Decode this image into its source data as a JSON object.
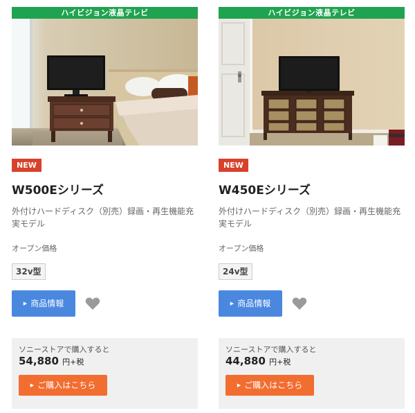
{
  "products": [
    {
      "category_banner": "ハイビジョン液晶テレビ",
      "badge": "NEW",
      "name": "W500Eシリーズ",
      "description": "外付けハードディスク（別売）録画・再生機能充実モデル",
      "price_label": "オープン価格",
      "size": "32v型",
      "info_button": "商品情報",
      "store_label": "ソニーストアで購入すると",
      "store_price": "54,880",
      "tax_suffix": "円+税",
      "buy_button": "ご購入はこちら"
    },
    {
      "category_banner": "ハイビジョン液晶テレビ",
      "badge": "NEW",
      "name": "W450Eシリーズ",
      "description": "外付けハードディスク（別売）録画・再生機能充実モデル",
      "price_label": "オープン価格",
      "size": "24v型",
      "info_button": "商品情報",
      "store_label": "ソニーストアで購入すると",
      "store_price": "44,880",
      "tax_suffix": "円+税",
      "buy_button": "ご購入はこちら"
    }
  ],
  "colors": {
    "banner": "#1fa350",
    "badge": "#d9412b",
    "info_button": "#4a88e0",
    "buy_button": "#f26d30",
    "store_box": "#f0f0f0",
    "heart": "#9a9a9a"
  },
  "icons": {
    "favorite": "heart-icon",
    "button_arrow": "triangle-right-icon"
  }
}
